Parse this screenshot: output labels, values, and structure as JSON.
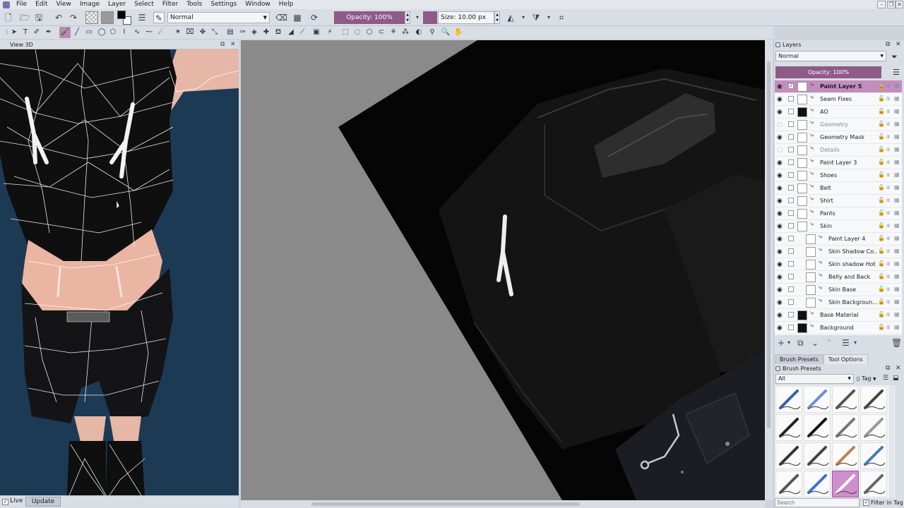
{
  "menubar": {
    "items": [
      "File",
      "Edit",
      "View",
      "Image",
      "Layer",
      "Select",
      "Filter",
      "Tools",
      "Settings",
      "Window",
      "Help"
    ]
  },
  "toolbar": {
    "blend_mode": "Normal",
    "opacity": "Opacity: 100%",
    "size": "Size: 10.00 px",
    "fg_color": "#000000",
    "bg_color": "#ffffff",
    "accent": "#8e5a88"
  },
  "view3d": {
    "title": "View 3D",
    "live_label": "Live",
    "live_checked": true,
    "update_button": "Update"
  },
  "layers": {
    "title": "Layers",
    "blend_mode": "Normal",
    "opacity": "Opacity:  100%",
    "items": [
      {
        "name": "Paint Layer 5",
        "visible": true,
        "selected": true,
        "indent": 0
      },
      {
        "name": "Seam Fixes",
        "visible": true,
        "indent": 0
      },
      {
        "name": "AO",
        "visible": true,
        "indent": 0
      },
      {
        "name": "Geometry",
        "visible": false,
        "indent": 0
      },
      {
        "name": "Geometry Mask",
        "visible": true,
        "indent": 0
      },
      {
        "name": "Details",
        "visible": false,
        "indent": 0
      },
      {
        "name": "Paint Layer 3",
        "visible": true,
        "indent": 0
      },
      {
        "name": "Shoes",
        "visible": true,
        "indent": 0
      },
      {
        "name": "Belt",
        "visible": true,
        "indent": 0
      },
      {
        "name": "Shirt",
        "visible": true,
        "indent": 0
      },
      {
        "name": "Pants",
        "visible": true,
        "indent": 0
      },
      {
        "name": "Skin",
        "visible": true,
        "indent": 0
      },
      {
        "name": "Paint Layer 4",
        "visible": true,
        "indent": 1
      },
      {
        "name": "Skin Shadow Co...",
        "visible": true,
        "indent": 1
      },
      {
        "name": "Skin shadow Hot",
        "visible": true,
        "indent": 1
      },
      {
        "name": "Belly and Back",
        "visible": true,
        "indent": 1
      },
      {
        "name": "Skin Base",
        "visible": true,
        "indent": 1
      },
      {
        "name": "Skin Backgroun...",
        "visible": true,
        "indent": 1
      },
      {
        "name": "Base Material",
        "visible": true,
        "indent": 0
      },
      {
        "name": "Background",
        "visible": true,
        "indent": 0
      }
    ]
  },
  "brush_presets": {
    "tabs": [
      "Brush Presets",
      "Tool Options"
    ],
    "title": "Brush Presets",
    "tag_filter": "All",
    "tag_label": "Tag",
    "search_placeholder": "Search",
    "filter_in_tag": "Filter in Tag"
  }
}
